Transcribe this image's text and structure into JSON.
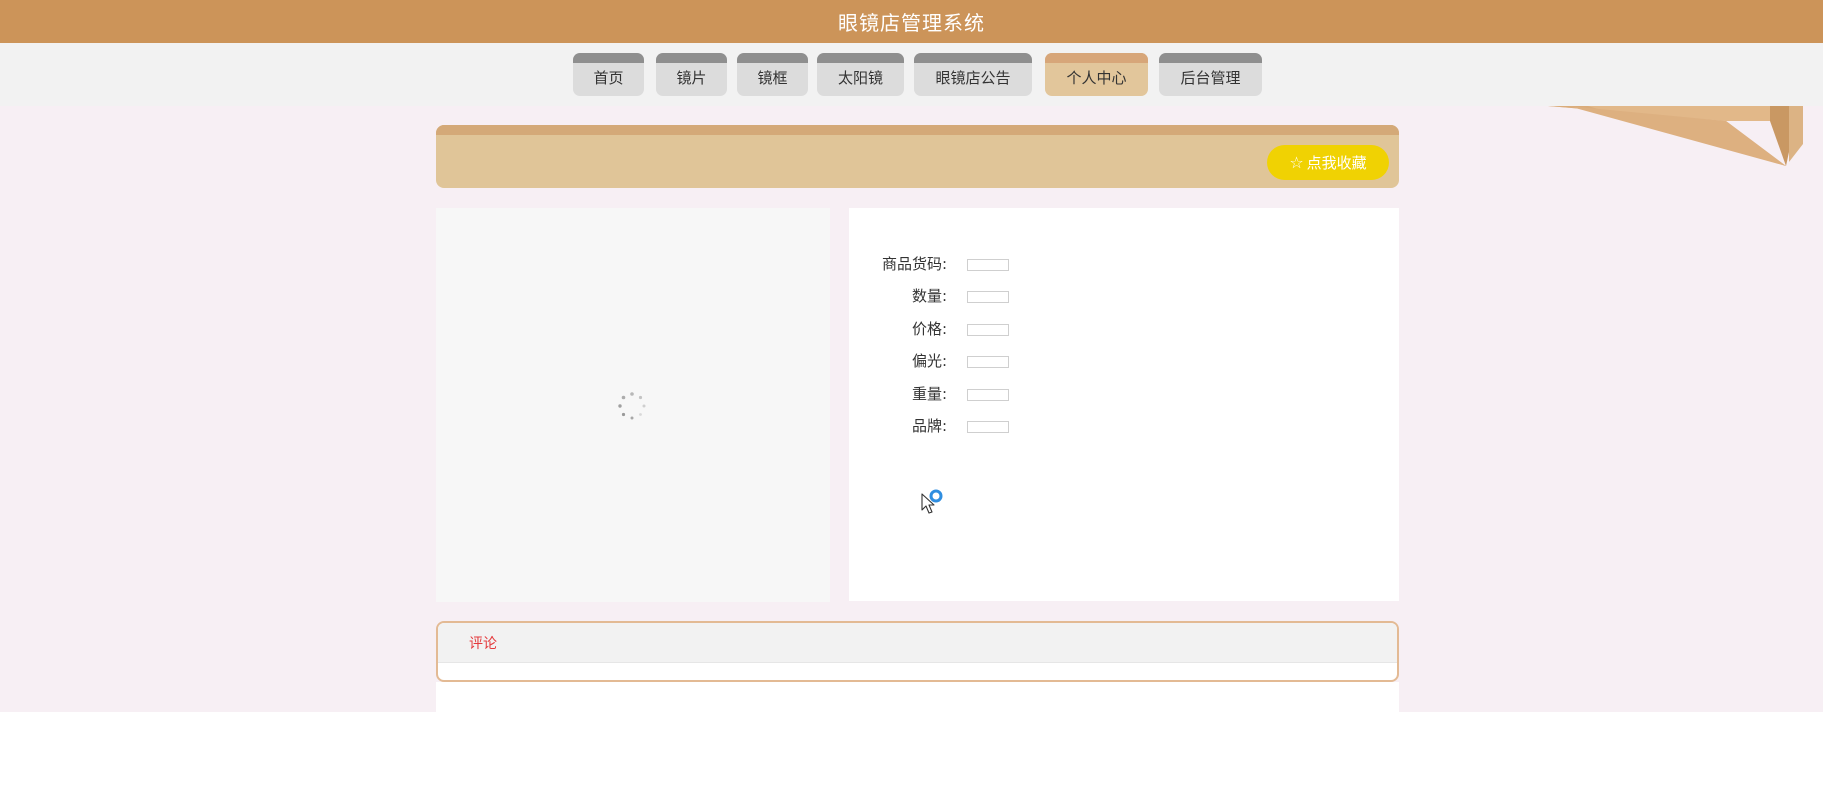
{
  "header": {
    "title": "眼镜店管理系统"
  },
  "nav": {
    "items": [
      {
        "label": "首页"
      },
      {
        "label": "镜片"
      },
      {
        "label": "镜框"
      },
      {
        "label": "太阳镜"
      },
      {
        "label": "眼镜店公告"
      },
      {
        "label": "个人中心",
        "active": true
      },
      {
        "label": "后台管理"
      }
    ]
  },
  "favorite": {
    "label": "点我收藏",
    "icon": "star-outline-icon"
  },
  "product": {
    "fields": [
      {
        "label": "商品货码:",
        "value": ""
      },
      {
        "label": "数量:",
        "value": ""
      },
      {
        "label": "价格:",
        "value": ""
      },
      {
        "label": "偏光:",
        "value": ""
      },
      {
        "label": "重量:",
        "value": ""
      },
      {
        "label": "品牌:",
        "value": ""
      }
    ]
  },
  "comments": {
    "tab_label": "评论"
  },
  "colors": {
    "header_bg": "#cc9459",
    "nav_active": "#e2c69b",
    "banner": "#e0c598",
    "favorite_button": "#f0d203",
    "comment_tab": "#e4393c",
    "page_bg": "#f7eff4"
  }
}
